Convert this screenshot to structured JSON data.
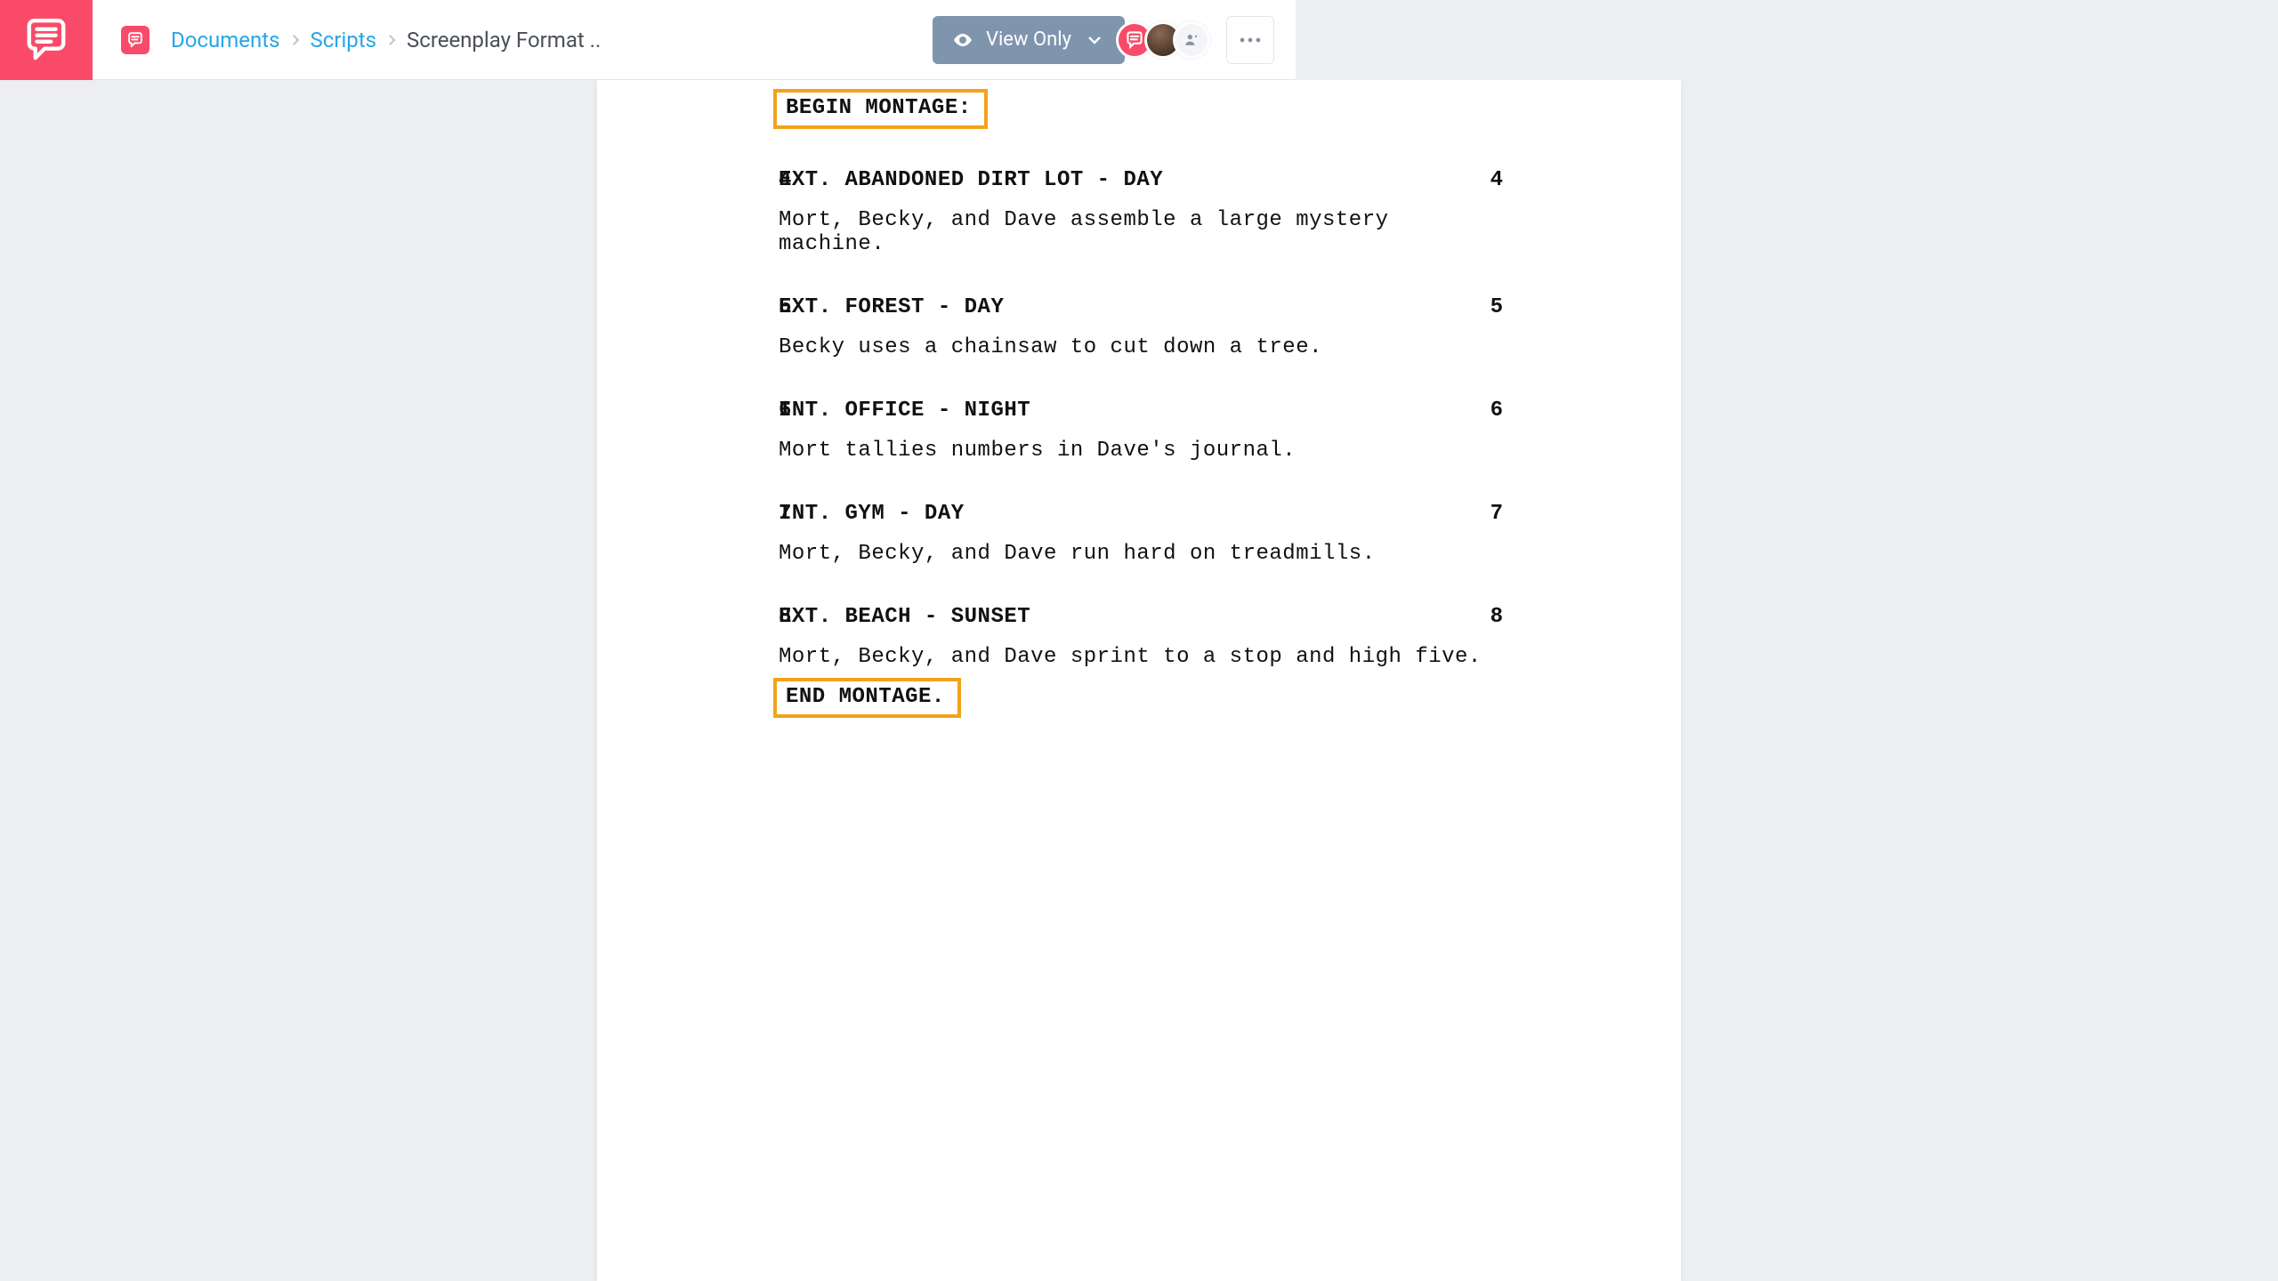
{
  "breadcrumbs": {
    "root": "Documents",
    "folder": "Scripts",
    "current": "Screenplay Format .."
  },
  "view_mode": {
    "label": "View Only"
  },
  "montage": {
    "begin": "BEGIN MONTAGE:",
    "end": "END MONTAGE."
  },
  "scenes": [
    {
      "n": "4",
      "heading": "EXT. ABANDONED DIRT LOT - DAY",
      "action": "Mort, Becky, and Dave assemble a large mystery machine."
    },
    {
      "n": "5",
      "heading": "EXT. FOREST - DAY",
      "action": "Becky uses a chainsaw to cut down a tree."
    },
    {
      "n": "6",
      "heading": "INT. OFFICE - NIGHT",
      "action": "Mort tallies numbers in Dave's journal."
    },
    {
      "n": "7",
      "heading": "INT. GYM - DAY",
      "action": "Mort, Becky, and Dave run hard on treadmills."
    },
    {
      "n": "8",
      "heading": "EXT. BEACH - SUNSET",
      "action": "Mort, Becky, and Dave sprint to a stop and high five."
    }
  ]
}
